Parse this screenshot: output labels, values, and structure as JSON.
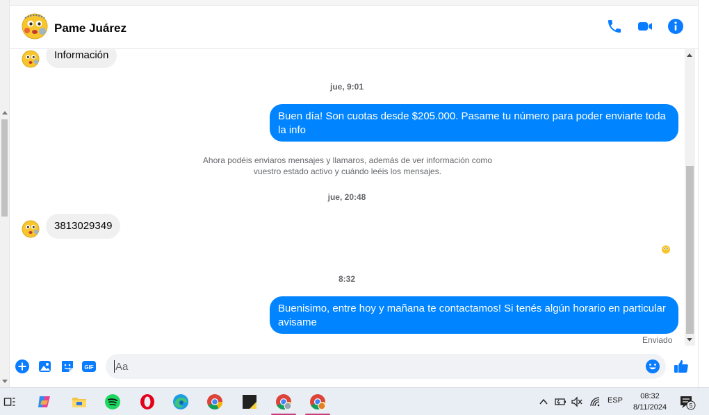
{
  "contact": {
    "name": "Pame Juárez"
  },
  "conversation": {
    "first_incoming": "Información",
    "ts1": "jue, 9:01",
    "out1": "Buen día! Son cuotas desde $205.000. Pasame tu número para poder enviarte toda la info",
    "system_notice": "Ahora podéis enviaros mensajes y llamaros, además de ver información como vuestro estado activo y cuándo leéis los mensajes.",
    "ts2": "jue, 20:48",
    "incoming2": "3813029349",
    "ts3": "8:32",
    "out2": "Buenisimo, entre hoy y mañana te contactamos! Si tenés algún horario en particular avisame",
    "status": "Enviado"
  },
  "composer": {
    "placeholder": "Aa"
  },
  "header_icons": [
    "phone-icon",
    "video-icon",
    "info-icon"
  ],
  "composer_icons": [
    "plus-icon",
    "image-icon",
    "sticker-icon",
    "gif-icon",
    "emoji-icon",
    "like-icon"
  ],
  "composer_gif_label": "GIF",
  "taskbar": {
    "icons": [
      "task-view-icon",
      "copilot-icon",
      "file-explorer-icon",
      "spotify-icon",
      "opera-icon",
      "edge-icon",
      "chrome-icon",
      "sticky-notes-icon",
      "chrome-profile-1-icon",
      "chrome-profile-2-icon"
    ],
    "language": "ESP",
    "time": "08:32",
    "date": "8/11/2024",
    "notification_count": "5"
  },
  "colors": {
    "accent": "#0084ff",
    "incoming_bubble": "#f0f0f0",
    "secondary_text": "#65676b"
  }
}
